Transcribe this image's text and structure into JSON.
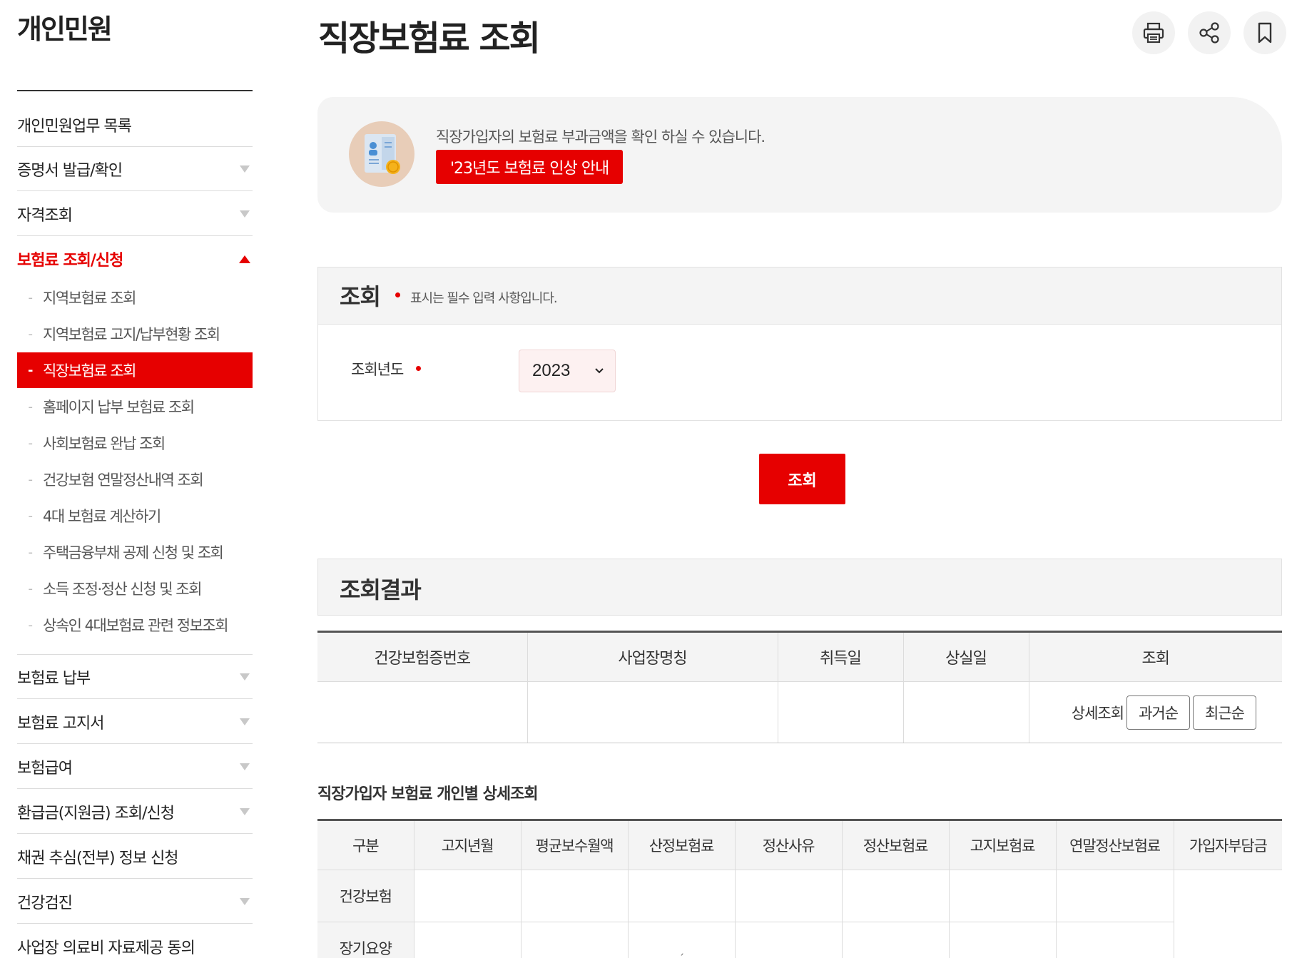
{
  "sidebar": {
    "title": "개인민원",
    "items": [
      {
        "label": "개인민원업무 목록"
      },
      {
        "label": "증명서 발급/확인"
      },
      {
        "label": "자격조회"
      },
      {
        "label": "보험료 조회/신청"
      },
      {
        "label": "보험료 납부"
      },
      {
        "label": "보험료 고지서"
      },
      {
        "label": "보험급여"
      },
      {
        "label": "환급금(지원금) 조회/신청"
      },
      {
        "label": "채권 추심(전부) 정보 신청"
      },
      {
        "label": "건강검진"
      },
      {
        "label": "사업장 의료비 자료제공 동의"
      }
    ],
    "subitems": [
      {
        "label": "지역보험료 조회"
      },
      {
        "label": "지역보험료 고지/납부현황 조회"
      },
      {
        "label": "직장보험료 조회"
      },
      {
        "label": "홈페이지 납부 보험료 조회"
      },
      {
        "label": "사회보험료 완납 조회"
      },
      {
        "label": "건강보험 연말정산내역 조회"
      },
      {
        "label": "4대 보험료 계산하기"
      },
      {
        "label": "주택금융부채 공제 신청 및 조회"
      },
      {
        "label": "소득 조정·정산 신청 및 조회"
      },
      {
        "label": "상속인 4대보험료 관련 정보조회"
      }
    ],
    "dash": "-"
  },
  "page": {
    "title": "직장보험료 조회"
  },
  "toolbar": {
    "icons": [
      "print-icon",
      "share-icon",
      "bookmark-icon"
    ]
  },
  "info": {
    "text": "직장가입자의 보험료 부과금액을 확인 하실 수 있습니다.",
    "button_label": "'23년도 보험료 인상 안내"
  },
  "search": {
    "heading": "조회",
    "required_note": "표시는 필수 입력 사항입니다.",
    "year_label": "조회년도",
    "year_value": "2023",
    "submit_label": "조회"
  },
  "result": {
    "heading": "조회결과",
    "columns": [
      "건강보험증번호",
      "사업장명칭",
      "취득일",
      "상실일",
      "조회"
    ],
    "detail_label": "상세조회",
    "sort_old": "과거순",
    "sort_new": "최근순"
  },
  "detail": {
    "title": "직장가입자 보험료 개인별 상세조회",
    "columns": [
      "구분",
      "고지년월",
      "평균보수월액",
      "산정보험료",
      "정산사유",
      "정산보험료",
      "고지보험료",
      "연말정산보험료",
      "가입자부담금"
    ],
    "rows": [
      "건강보험",
      "장기요양"
    ],
    "stray_mark": "ˏ"
  },
  "colors": {
    "accent": "#e60000",
    "panel": "#f4f4f4"
  }
}
